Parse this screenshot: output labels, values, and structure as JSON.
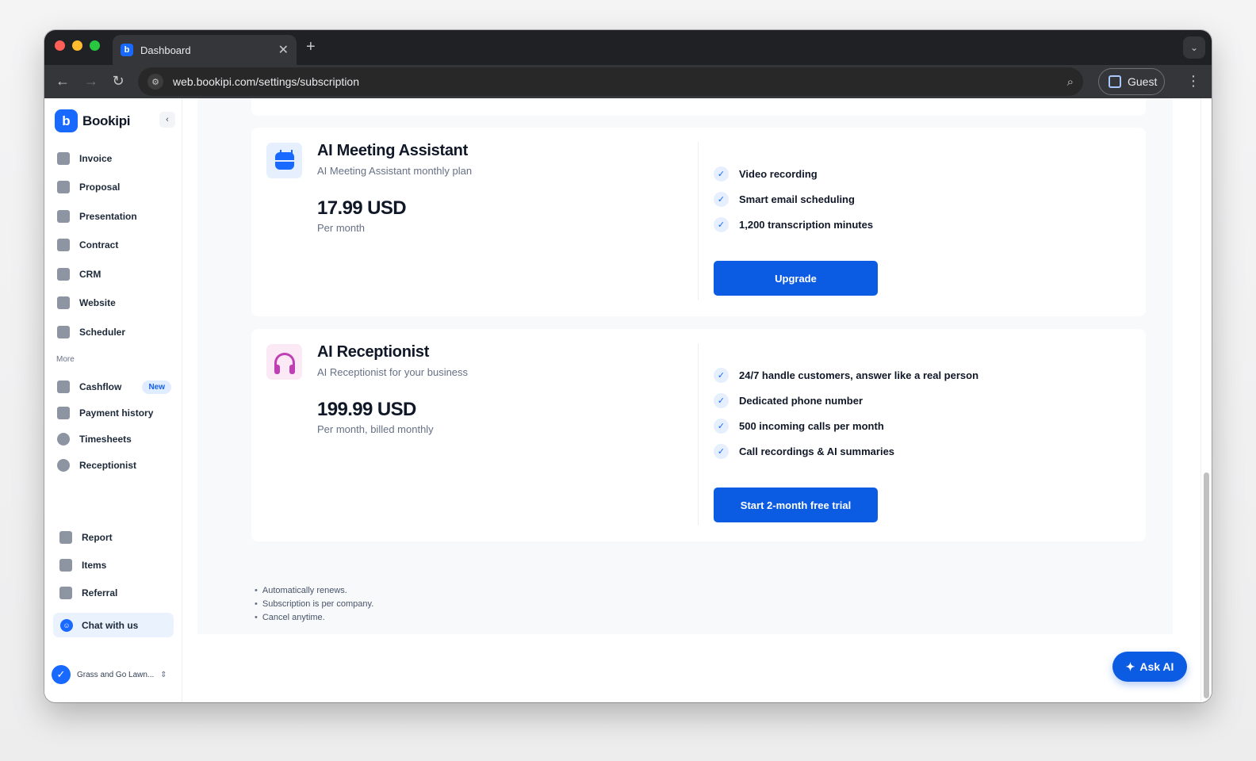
{
  "browser": {
    "tab_title": "Dashboard",
    "tab_close": "✕",
    "new_tab": "+",
    "url": "web.bookipi.com/settings/subscription",
    "profile_label": "Guest"
  },
  "sidebar": {
    "brand": "Bookipi",
    "items": [
      {
        "label": "Invoice",
        "icon": "invoice-icon"
      },
      {
        "label": "Proposal",
        "icon": "proposal-icon"
      },
      {
        "label": "Presentation",
        "icon": "presentation-icon"
      },
      {
        "label": "Contract",
        "icon": "contract-icon"
      },
      {
        "label": "CRM",
        "icon": "crm-icon"
      },
      {
        "label": "Website",
        "icon": "website-icon"
      },
      {
        "label": "Scheduler",
        "icon": "scheduler-icon"
      }
    ],
    "more_label": "More",
    "more_items": [
      {
        "label": "Cashflow",
        "icon": "cashflow-icon",
        "badge": "New"
      },
      {
        "label": "Payment history",
        "icon": "payment-history-icon"
      },
      {
        "label": "Timesheets",
        "icon": "timesheets-icon"
      },
      {
        "label": "Receptionist",
        "icon": "receptionist-icon"
      }
    ],
    "bottom_items": [
      {
        "label": "Report",
        "icon": "report-icon"
      },
      {
        "label": "Items",
        "icon": "items-icon"
      },
      {
        "label": "Referral",
        "icon": "gift-icon"
      }
    ],
    "chat_label": "Chat with us",
    "company_name": "Grass and Go Lawn..."
  },
  "plans": [
    {
      "name": "AI Meeting Assistant",
      "subtitle": "AI Meeting Assistant monthly plan",
      "price": "17.99 USD",
      "period": "Per month",
      "features": [
        "Video recording",
        "Smart email scheduling",
        "1,200 transcription minutes"
      ],
      "cta": "Upgrade",
      "icon": "calendar-icon"
    },
    {
      "name": "AI Receptionist",
      "subtitle": "AI Receptionist for your business",
      "price": "199.99 USD",
      "period": "Per month, billed monthly",
      "features": [
        "24/7 handle customers, answer like a real person",
        "Dedicated phone number",
        "500 incoming calls per month",
        "Call recordings & AI summaries"
      ],
      "cta": "Start 2-month free trial",
      "icon": "headset-icon"
    }
  ],
  "notes": [
    "Automatically renews.",
    "Subscription is per company.",
    "Cancel anytime."
  ],
  "ask_ai_label": "Ask AI",
  "colors": {
    "accent": "#0c5be3",
    "brand": "#1769ff"
  }
}
